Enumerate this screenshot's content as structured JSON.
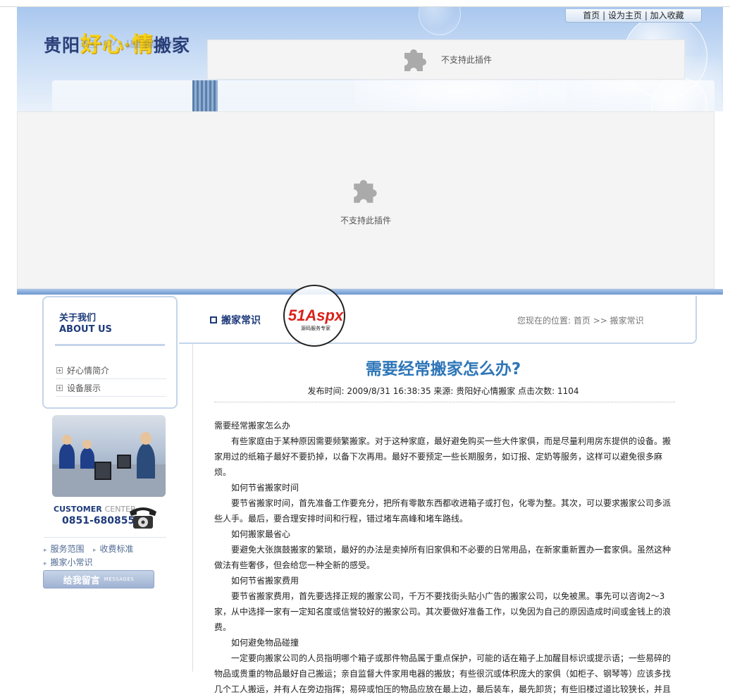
{
  "header": {
    "logo_prefix": "贵阳",
    "logo_highlight": "好心·情",
    "logo_suffix": "搬家",
    "links": [
      "首页",
      "设为主页",
      "加入收藏"
    ]
  },
  "plugins": {
    "message": "不支持此插件"
  },
  "sidebar": {
    "about_cn": "关于我们",
    "about_en": "ABOUT US",
    "menu": [
      "好心情简介",
      "设备展示"
    ],
    "customer_label": "CUSTOMER",
    "customer_label2": "CENTER",
    "phone": "0851-6808555",
    "links": [
      "服务范围",
      "收费标准",
      "搬家小常识"
    ],
    "message_button": "给我留言",
    "message_button_en": "MESSAGES"
  },
  "section": {
    "title": "搬家常识",
    "watermark": "51Aspx",
    "watermark_sub": "源码服务专家",
    "breadcrumb_prefix": "您现在的位置:",
    "breadcrumb_home": "首页",
    "breadcrumb_sep": ">>",
    "breadcrumb_current": "搬家常识"
  },
  "article": {
    "title": "需要经常搬家怎么办?",
    "meta": "发布时间: 2009/8/31 16:38:35 来源: 贵阳好心情搬家 点击次数: 1104",
    "paragraphs": [
      "需要经常搬家怎么办",
      "　　有些家庭由于某种原因需要频繁搬家。对于这种家庭，最好避免购买一些大件家俱，而是尽量利用房东提供的设备。搬家用过的纸箱子最好不要扔掉，以备下次再用。最好不要预定一些长期服务，如订报、定奶等服务，这样可以避免很多麻烦。",
      "　　如何节省搬家时间",
      "　　要节省搬家时间，首先准备工作要充分，把所有零散东西都收进箱子或打包，化零为整。其次，可以要求搬家公司多派些人手。最后，要合理安排时间和行程，错过堵车高峰和堵车路线。",
      "　　如何搬家最省心",
      "　　要避免大张旗鼓搬家的繁琐，最好的办法是卖掉所有旧家俱和不必要的日常用品，在新家重新置办一套家俱。虽然这种做法有些奢侈，但会给您一种全新的感受。",
      "　　如何节省搬家费用",
      "　　要节省搬家费用，首先要选择正规的搬家公司，千万不要找街头贴小广告的搬家公司，以免被黑。事先可以咨询2～3家，从中选择一家有一定知名度或信誉较好的搬家公司。其次要做好准备工作，以免因为自己的原因造成时间或金钱上的浪费。",
      "　　如何避免物品碰撞",
      "　　一定要向搬家公司的人员指明哪个箱子或那件物品属于重点保护，可能的话在箱子上加醒目标识或提示语；一些易碎的物品或贵重的物品最好自己搬运；亲自监督大件家用电器的搬放；有些很沉或体积庞大的家俱（如柜子、钢琴等）应该多找几个工人搬运，并有人在旁边指挥；易碎或怕压的物品应放在最上边，最后装车，最先卸货；有些旧楼过道比较狭长，并且"
    ]
  },
  "colors": {
    "brand_blue": "#1d3a7a",
    "title_blue": "#2e76b8",
    "logo_yellow": "#f5d21a",
    "border_blue": "#c4d5ea"
  }
}
